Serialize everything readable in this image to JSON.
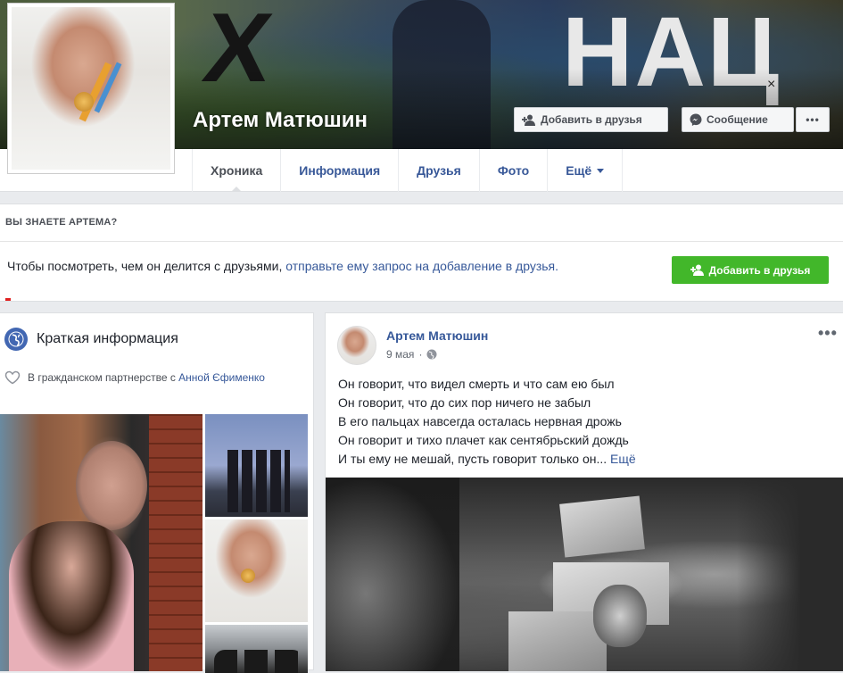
{
  "profile": {
    "name": "Артем Матюшин",
    "add_friend_label": "Добавить в друзья",
    "message_label": "Сообщение",
    "more_label": "•••"
  },
  "tabs": [
    {
      "label": "Хроника",
      "active": true
    },
    {
      "label": "Информация",
      "active": false
    },
    {
      "label": "Друзья",
      "active": false
    },
    {
      "label": "Фото",
      "active": false
    },
    {
      "label": "Ещё",
      "active": false,
      "dropdown": true
    }
  ],
  "know_box": {
    "title": "ВЫ ЗНАЕТЕ АРТЕМА?",
    "text_plain": "Чтобы посмотреть, чем он делится с друзьями, ",
    "text_link": "отправьте ему запрос на добавление в друзья.",
    "button_label": "Добавить в друзья"
  },
  "intro": {
    "title": "Краткая информация",
    "relationship_text": "В гражданском партнерстве с ",
    "relationship_link": "Анной Єфименко"
  },
  "post": {
    "author": "Артем Матюшин",
    "date": "9 мая",
    "privacy_icon": "globe-icon",
    "options": "•••",
    "lines": [
      "Он говорит, что видел смерть и что сам ею был",
      "Он говорит, что до сих пор ничего не забыл",
      "В его пальцах навсегда осталась нервная дрожь",
      "Он говорит и тихо плачет как сентябрьский дождь",
      "И ты ему не мешай, пусть говорит только он..."
    ],
    "see_more": "Ещё"
  },
  "colors": {
    "link": "#365899",
    "green": "#42b72a",
    "globe": "#4267b2",
    "background": "#e9ebee"
  }
}
